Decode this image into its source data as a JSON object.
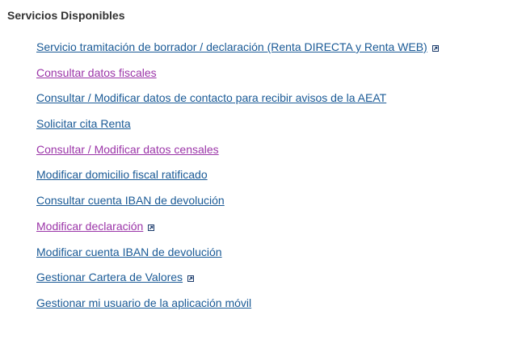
{
  "section": {
    "title": "Servicios Disponibles"
  },
  "colors": {
    "link": "#1a5a96",
    "visited_link": "#9b35a8",
    "title": "#333333"
  },
  "services": [
    {
      "label": "Servicio tramitación de borrador / declaración (Renta DIRECTA y Renta WEB)",
      "visited": false,
      "external": true,
      "icon": "external-link-icon"
    },
    {
      "label": "Consultar datos fiscales",
      "visited": true,
      "external": false
    },
    {
      "label": "Consultar / Modificar datos de contacto para recibir avisos de la AEAT",
      "visited": false,
      "external": false
    },
    {
      "label": "Solicitar cita Renta",
      "visited": false,
      "external": false
    },
    {
      "label": "Consultar / Modificar datos censales",
      "visited": true,
      "external": false
    },
    {
      "label": "Modificar domicilio fiscal ratificado",
      "visited": false,
      "external": false
    },
    {
      "label": "Consultar cuenta IBAN de devolución",
      "visited": false,
      "external": false
    },
    {
      "label": "Modificar declaración",
      "visited": true,
      "external": true,
      "icon": "external-link-icon"
    },
    {
      "label": "Modificar cuenta IBAN de devolución",
      "visited": false,
      "external": false
    },
    {
      "label": "Gestionar Cartera de Valores",
      "visited": false,
      "external": true,
      "icon": "external-link-icon"
    },
    {
      "label": "Gestionar mi usuario de la aplicación móvil",
      "visited": false,
      "external": false
    }
  ]
}
